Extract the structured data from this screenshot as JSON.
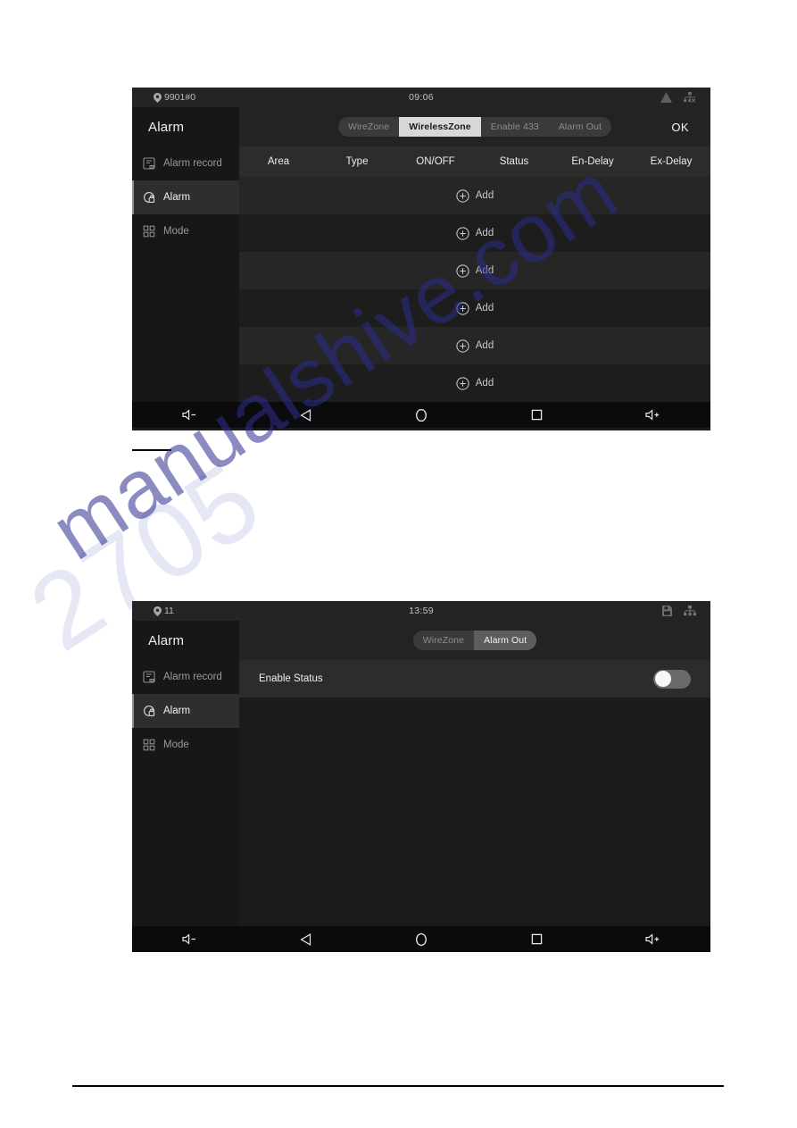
{
  "page": {
    "watermark": "manualshive.com",
    "watermark_ghost": "2705"
  },
  "screens": [
    {
      "id": "wireless-zone-screen",
      "statusbar": {
        "location": "9901#0",
        "time": "09:06",
        "icons": [
          "warning-triangle-icon",
          "ethernet-disconnected-icon"
        ]
      },
      "sidebar": {
        "title": "Alarm",
        "items": [
          {
            "label": "Alarm record",
            "icon": "alarm-record-icon",
            "active": false
          },
          {
            "label": "Alarm",
            "icon": "alarm-shield-icon",
            "active": true
          },
          {
            "label": "Mode",
            "icon": "mode-grid-icon",
            "active": false
          }
        ]
      },
      "topbar": {
        "tabs": [
          {
            "label": "WireZone",
            "active": false
          },
          {
            "label": "WirelessZone",
            "active": true
          },
          {
            "label": "Enable 433",
            "active": false
          },
          {
            "label": "Alarm Out",
            "active": false
          }
        ],
        "ok_label": "OK"
      },
      "table": {
        "columns": [
          "Area",
          "Type",
          "ON/OFF",
          "Status",
          "En-Delay",
          "Ex-Delay"
        ],
        "rows": [
          {
            "label": "Add"
          },
          {
            "label": "Add"
          },
          {
            "label": "Add"
          },
          {
            "label": "Add"
          },
          {
            "label": "Add"
          },
          {
            "label": "Add"
          }
        ]
      },
      "navbar": [
        "volume-down-icon",
        "back-triangle-icon",
        "home-circle-icon",
        "recents-square-icon",
        "volume-up-icon"
      ]
    },
    {
      "id": "alarm-out-screen",
      "statusbar": {
        "location": "11",
        "time": "13:59",
        "icons": [
          "sd-card-icon",
          "ethernet-icon"
        ]
      },
      "sidebar": {
        "title": "Alarm",
        "items": [
          {
            "label": "Alarm record",
            "icon": "alarm-record-icon",
            "active": false
          },
          {
            "label": "Alarm",
            "icon": "alarm-shield-icon",
            "active": true
          },
          {
            "label": "Mode",
            "icon": "mode-grid-icon",
            "active": false
          }
        ]
      },
      "topbar": {
        "tabs": [
          {
            "label": "WireZone",
            "active": false
          },
          {
            "label": "Alarm Out",
            "active": true
          }
        ],
        "ok_label": ""
      },
      "settings": [
        {
          "label": "Enable Status",
          "control": "toggle",
          "value": "off"
        }
      ],
      "navbar": [
        "volume-down-icon",
        "back-triangle-icon",
        "home-circle-icon",
        "recents-square-icon",
        "volume-up-icon"
      ]
    }
  ]
}
